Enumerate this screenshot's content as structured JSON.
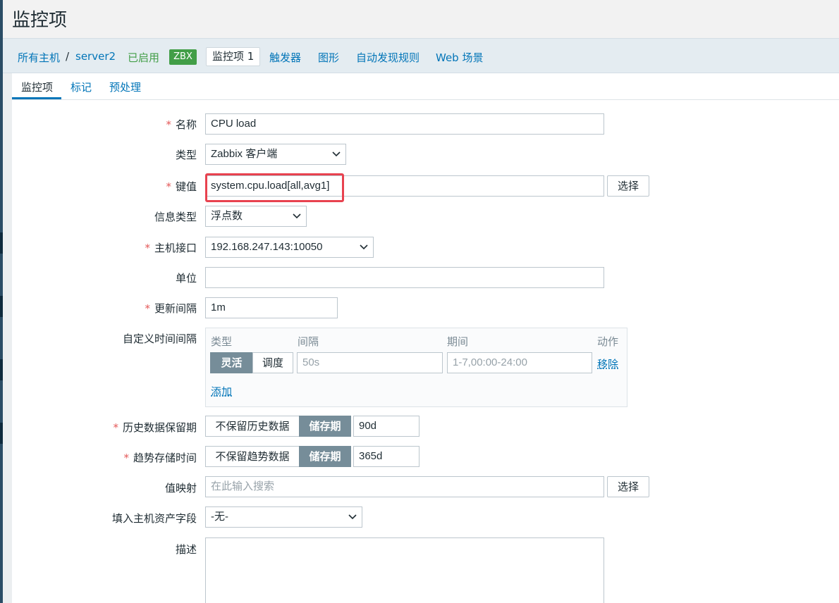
{
  "page": {
    "title": "监控项"
  },
  "breadcrumb": {
    "all_hosts": "所有主机",
    "separator": "/",
    "host": "server2",
    "status": "已启用",
    "zbx_badge": "ZBX",
    "items_tab": "监控项 1",
    "triggers": "触发器",
    "graphs": "图形",
    "discovery_rules": "自动发现规则",
    "web": "Web 场景"
  },
  "tabs": [
    "监控项",
    "标记",
    "预处理"
  ],
  "form": {
    "name": {
      "label": "名称",
      "value": "CPU load"
    },
    "type": {
      "label": "类型",
      "value": "Zabbix 客户端"
    },
    "key": {
      "label": "键值",
      "value": "system.cpu.load[all,avg1]",
      "select_button": "选择"
    },
    "info_type": {
      "label": "信息类型",
      "value": "浮点数"
    },
    "host_interface": {
      "label": "主机接口",
      "value": "192.168.247.143:10050"
    },
    "units": {
      "label": "单位",
      "value": ""
    },
    "update_interval": {
      "label": "更新间隔",
      "value": "1m"
    },
    "custom_intervals": {
      "label": "自定义时间间隔",
      "headers": {
        "type": "类型",
        "interval": "间隔",
        "period": "期间",
        "action": "动作"
      },
      "row": {
        "flexible": "灵活",
        "scheduling": "调度",
        "interval_placeholder": "50s",
        "period_placeholder": "1-7,00:00-24:00",
        "remove": "移除"
      },
      "add": "添加"
    },
    "history": {
      "label": "历史数据保留期",
      "no_keep": "不保留历史数据",
      "storage": "储存期",
      "value": "90d"
    },
    "trends": {
      "label": "趋势存储时间",
      "no_keep": "不保留趋势数据",
      "storage": "储存期",
      "value": "365d"
    },
    "value_map": {
      "label": "值映射",
      "placeholder": "在此输入搜索",
      "select_button": "选择"
    },
    "inventory": {
      "label": "填入主机资产字段",
      "value": "-无-"
    },
    "description": {
      "label": "描述",
      "value": ""
    }
  },
  "colors": {
    "link": "#0275b8",
    "enabled": "#429e47",
    "required": "#e45959",
    "highlight": "#e8424f",
    "segment_active": "#768d99"
  }
}
